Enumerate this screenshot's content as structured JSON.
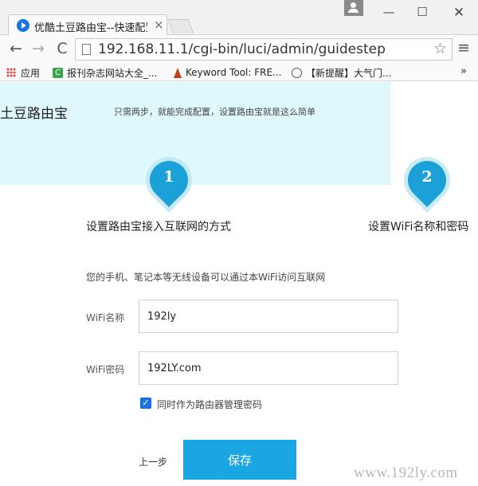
{
  "browser": {
    "tab_title": "优酷土豆路由宝--快速配置",
    "tab_close": "×",
    "url": "192.168.11.1/cgi-bin/luci/admin/guidestep",
    "icons": {
      "back": "←",
      "forward": "→",
      "reload": "C",
      "star": "☆",
      "menu": "≡",
      "minimize": "—",
      "maximize": "☐",
      "close": "✕"
    },
    "bookmarks": [
      {
        "label": "应用"
      },
      {
        "label": "报刊杂志网站大全_...",
        "icon_text": "C"
      },
      {
        "label": "Keyword Tool: FRE..."
      },
      {
        "label": "【新提醒】大气门..."
      }
    ],
    "bookmarks_more": "»"
  },
  "page": {
    "brand_title": "土豆路由宝",
    "hero_subtitle": "只需两步，就能完成配置，设置路由宝就是这么简单",
    "steps": [
      {
        "number": "1",
        "label": "设置路由宝接入互联网的方式"
      },
      {
        "number": "2",
        "label": "设置WiFi名称和密码"
      }
    ],
    "description": "您的手机、笔记本等无线设备可以通过本WiFi访问互联网",
    "form": {
      "ssid_label": "WiFi名称",
      "ssid_value": "192ly",
      "password_label": "WiFi密码",
      "password_value": "192LY.com",
      "same_as_admin_checked": true,
      "check_mark": "✓",
      "same_as_admin_label": "同时作为路由器管理密码"
    },
    "prev_label": "上一步",
    "save_label": "保存"
  },
  "watermark": "www.192ly.com",
  "colors": {
    "hero_background": "#dff8fc",
    "accent": "#1aa6e3",
    "step_badge": "#1ba0d8",
    "checkbox": "#1a73e8"
  }
}
